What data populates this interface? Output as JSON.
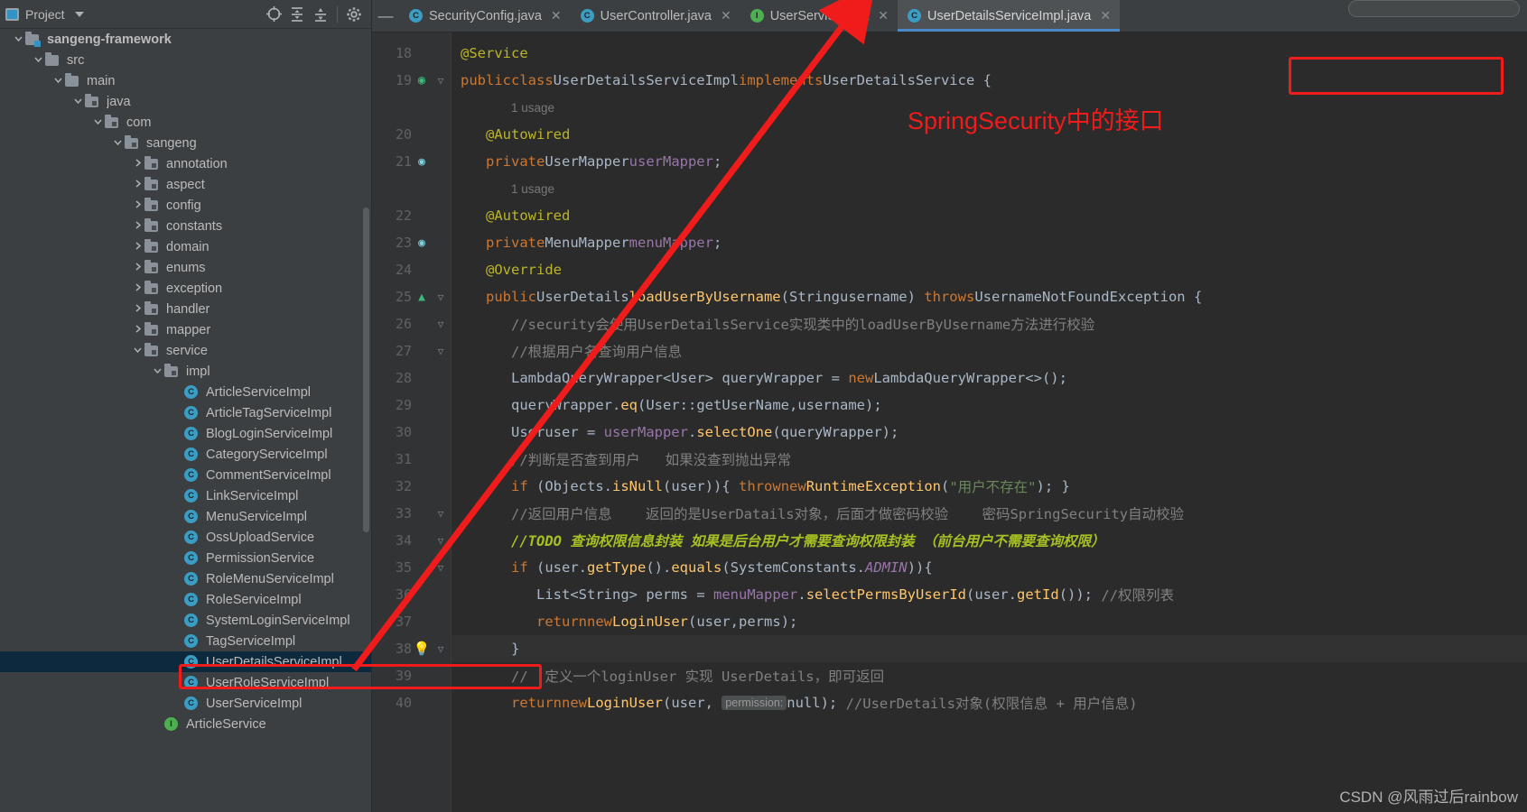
{
  "sidebar": {
    "toolbar": {
      "panel_label": "Project",
      "icons": [
        "locate-icon",
        "expand-all-icon",
        "collapse-all-icon",
        "gear-icon"
      ]
    },
    "tree": [
      {
        "label": "sangeng-framework",
        "depth": 0,
        "arrow": "down",
        "icon": "module-folder-icon",
        "bold": true
      },
      {
        "label": "src",
        "depth": 1,
        "arrow": "down",
        "icon": "folder-icon"
      },
      {
        "label": "main",
        "depth": 2,
        "arrow": "down",
        "icon": "folder-icon"
      },
      {
        "label": "java",
        "depth": 3,
        "arrow": "down",
        "icon": "source-folder-icon"
      },
      {
        "label": "com",
        "depth": 4,
        "arrow": "down",
        "icon": "package-icon"
      },
      {
        "label": "sangeng",
        "depth": 5,
        "arrow": "down",
        "icon": "package-icon"
      },
      {
        "label": "annotation",
        "depth": 6,
        "arrow": "right",
        "icon": "package-icon"
      },
      {
        "label": "aspect",
        "depth": 6,
        "arrow": "right",
        "icon": "package-icon"
      },
      {
        "label": "config",
        "depth": 6,
        "arrow": "right",
        "icon": "package-icon"
      },
      {
        "label": "constants",
        "depth": 6,
        "arrow": "right",
        "icon": "package-icon"
      },
      {
        "label": "domain",
        "depth": 6,
        "arrow": "right",
        "icon": "package-icon"
      },
      {
        "label": "enums",
        "depth": 6,
        "arrow": "right",
        "icon": "package-icon"
      },
      {
        "label": "exception",
        "depth": 6,
        "arrow": "right",
        "icon": "package-icon"
      },
      {
        "label": "handler",
        "depth": 6,
        "arrow": "right",
        "icon": "package-icon"
      },
      {
        "label": "mapper",
        "depth": 6,
        "arrow": "right",
        "icon": "package-icon"
      },
      {
        "label": "service",
        "depth": 6,
        "arrow": "down",
        "icon": "package-icon"
      },
      {
        "label": "impl",
        "depth": 7,
        "arrow": "down",
        "icon": "package-icon"
      },
      {
        "label": "ArticleServiceImpl",
        "depth": 8,
        "arrow": "none",
        "icon": "class-icon"
      },
      {
        "label": "ArticleTagServiceImpl",
        "depth": 8,
        "arrow": "none",
        "icon": "class-icon"
      },
      {
        "label": "BlogLoginServiceImpl",
        "depth": 8,
        "arrow": "none",
        "icon": "class-icon"
      },
      {
        "label": "CategoryServiceImpl",
        "depth": 8,
        "arrow": "none",
        "icon": "class-icon"
      },
      {
        "label": "CommentServiceImpl",
        "depth": 8,
        "arrow": "none",
        "icon": "class-icon"
      },
      {
        "label": "LinkServiceImpl",
        "depth": 8,
        "arrow": "none",
        "icon": "class-icon"
      },
      {
        "label": "MenuServiceImpl",
        "depth": 8,
        "arrow": "none",
        "icon": "class-icon"
      },
      {
        "label": "OssUploadService",
        "depth": 8,
        "arrow": "none",
        "icon": "class-icon"
      },
      {
        "label": "PermissionService",
        "depth": 8,
        "arrow": "none",
        "icon": "class-icon"
      },
      {
        "label": "RoleMenuServiceImpl",
        "depth": 8,
        "arrow": "none",
        "icon": "class-icon"
      },
      {
        "label": "RoleServiceImpl",
        "depth": 8,
        "arrow": "none",
        "icon": "class-icon"
      },
      {
        "label": "SystemLoginServiceImpl",
        "depth": 8,
        "arrow": "none",
        "icon": "class-icon"
      },
      {
        "label": "TagServiceImpl",
        "depth": 8,
        "arrow": "none",
        "icon": "class-icon"
      },
      {
        "label": "UserDetailsServiceImpl",
        "depth": 8,
        "arrow": "none",
        "icon": "class-icon",
        "selected": true
      },
      {
        "label": "UserRoleServiceImpl",
        "depth": 8,
        "arrow": "none",
        "icon": "class-icon"
      },
      {
        "label": "UserServiceImpl",
        "depth": 8,
        "arrow": "none",
        "icon": "class-icon"
      },
      {
        "label": "ArticleService",
        "depth": 7,
        "arrow": "none",
        "icon": "interface-icon"
      }
    ]
  },
  "editor": {
    "tabs": [
      {
        "label": "SecurityConfig.java",
        "icon": "class-icon",
        "active": false,
        "closable": true
      },
      {
        "label": "UserController.java",
        "icon": "class-icon",
        "active": false,
        "closable": true
      },
      {
        "label": "UserService.java",
        "icon": "interface-icon",
        "active": false,
        "closable": true
      },
      {
        "label": "UserDetailsServiceImpl.java",
        "icon": "class-icon",
        "active": true,
        "closable": true
      }
    ],
    "first_line_number": 18,
    "lines": [
      {
        "num": "18",
        "text": "@Service"
      },
      {
        "num": "19",
        "text": "public class UserDetailsServiceImpl implements UserDetailsService {",
        "mark": "class-implemented-icon"
      },
      {
        "num": "",
        "text": "1 usage",
        "kind": "usage-hint"
      },
      {
        "num": "20",
        "text": "@Autowired"
      },
      {
        "num": "21",
        "text": "private UserMapper userMapper;",
        "mark": "bean-icon"
      },
      {
        "num": "",
        "text": "1 usage",
        "kind": "usage-hint"
      },
      {
        "num": "22",
        "text": "@Autowired"
      },
      {
        "num": "23",
        "text": "private MenuMapper menuMapper;",
        "mark": "bean-icon"
      },
      {
        "num": "24",
        "text": "@Override"
      },
      {
        "num": "25",
        "text": "public UserDetails loadUserByUsername(String username) throws UsernameNotFoundException {",
        "mark": "override-icon"
      },
      {
        "num": "26",
        "text": "//security会使用UserDetailsService实现类中的loadUserByUsername方法进行校验"
      },
      {
        "num": "27",
        "text": "//根据用户名查询用户信息"
      },
      {
        "num": "28",
        "text": "LambdaQueryWrapper<User> queryWrapper = new LambdaQueryWrapper<>();"
      },
      {
        "num": "29",
        "text": "queryWrapper.eq(User::getUserName,username);"
      },
      {
        "num": "30",
        "text": "User user = userMapper.selectOne(queryWrapper);"
      },
      {
        "num": "31",
        "text": "//判断是否查到用户   如果没查到抛出异常"
      },
      {
        "num": "32",
        "text": "if (Objects.isNull(user)){ throw new RuntimeException(\"用户不存在\"); }"
      },
      {
        "num": "33",
        "text": "//返回用户信息    返回的是UserDatails对象，后面才做密码校验    密码SpringSecurity自动校验"
      },
      {
        "num": "34",
        "text": "//TODO 查询权限信息封装 如果是后台用户才需要查询权限封装 （前台用户不需要查询权限）"
      },
      {
        "num": "35",
        "text": "if (user.getType().equals(SystemConstants.ADMIN)){"
      },
      {
        "num": "36",
        "text": "List<String> perms = menuMapper.selectPermsByUserId(user.getId()); //权限列表"
      },
      {
        "num": "37",
        "text": "return new LoginUser(user,perms);"
      },
      {
        "num": "38",
        "text": "}",
        "current": true,
        "mark": "bulb-icon"
      },
      {
        "num": "39",
        "text": "//  定义一个loginUser 实现 UserDetails，即可返回"
      },
      {
        "num": "40",
        "text": "return new LoginUser(user, permission: null); //UserDetails对象(权限信息 + 用户信息)"
      }
    ]
  },
  "annotations": {
    "callout_text": "SpringSecurity中的接口",
    "callout_color": "#f01c1c",
    "boxes": [
      {
        "name": "interface-name-box",
        "target": "UserDetailsService"
      },
      {
        "name": "tree-file-box",
        "target": "UserDetailsServiceImpl"
      }
    ],
    "arrow": {
      "name": "red-arrow",
      "from": "UserDetailsServiceImpl tree item",
      "to": "UserDetailsServiceImpl.java tab"
    }
  },
  "watermark": "CSDN @风雨过后rainbow"
}
